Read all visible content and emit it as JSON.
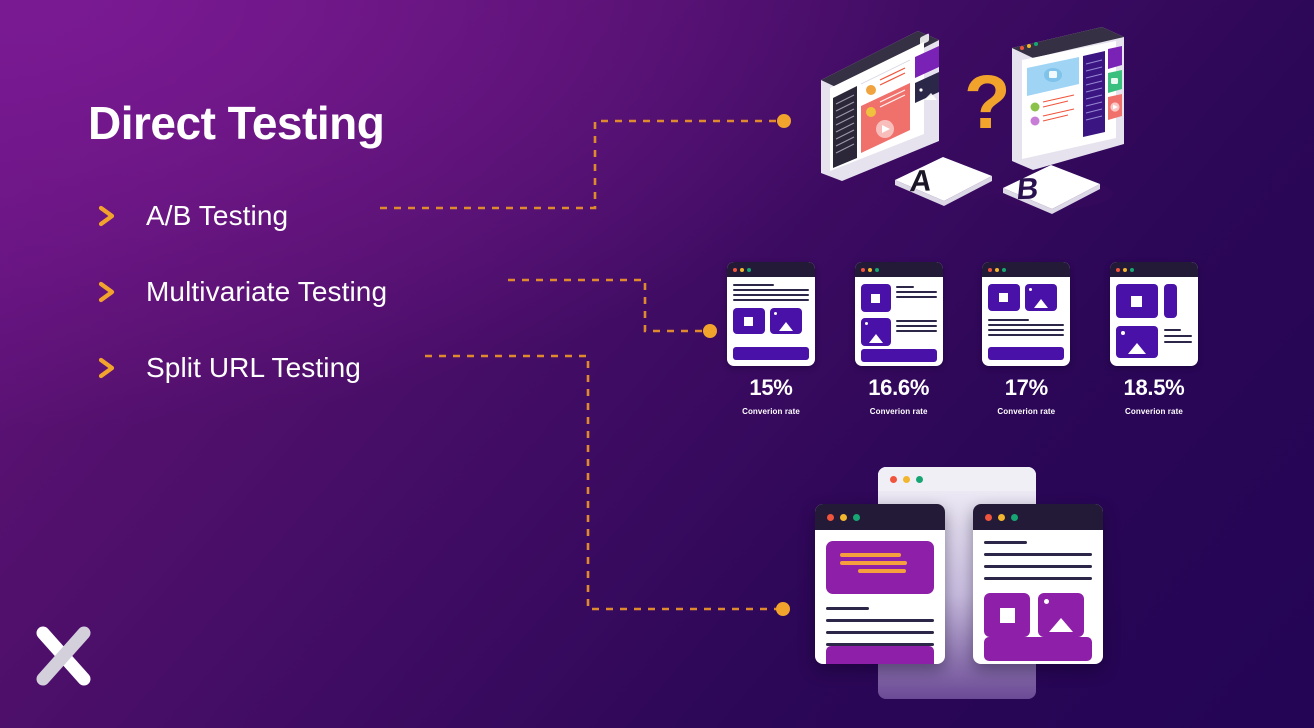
{
  "slide": {
    "title": "Direct Testing",
    "background_from": "#6C1487",
    "background_to": "#230455",
    "accent_color": "#F2A32C",
    "text_color": "#FFFFFF"
  },
  "list": {
    "items": [
      {
        "label": "A/B Testing",
        "marker": "chevron-right-icon"
      },
      {
        "label": "Multivariate Testing",
        "marker": "chevron-right-icon"
      },
      {
        "label": "Split URL Testing",
        "marker": "chevron-right-icon"
      }
    ]
  },
  "illustration_ab": {
    "name": "ab-test-illustration",
    "question_mark": "?",
    "tiles": [
      {
        "letter": "A"
      },
      {
        "letter": "B"
      }
    ]
  },
  "illustration_multivariate": {
    "name": "multivariate-variants-illustration",
    "caption": "Converion rate",
    "variants": [
      {
        "percent": "15%",
        "caption": "Converion rate"
      },
      {
        "percent": "16.6%",
        "caption": "Converion rate"
      },
      {
        "percent": "17%",
        "caption": "Converion rate"
      },
      {
        "percent": "18.5%",
        "caption": "Converion rate"
      }
    ]
  },
  "illustration_split": {
    "name": "split-url-illustration",
    "pages": [
      {
        "variant": "page-a"
      },
      {
        "variant": "page-b"
      }
    ]
  },
  "logo": {
    "name": "x-logo",
    "alt": "X"
  }
}
